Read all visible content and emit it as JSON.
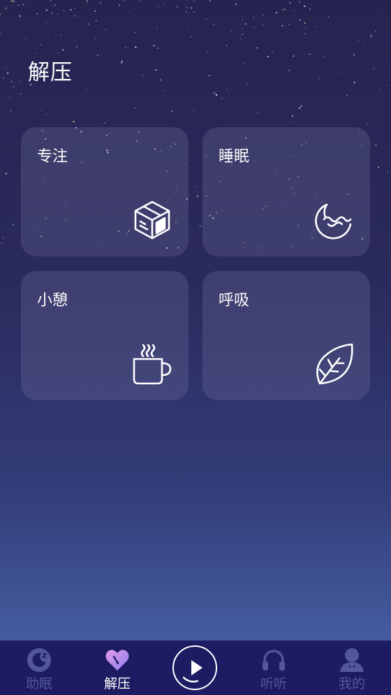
{
  "page": {
    "title": "解压"
  },
  "cards": [
    {
      "label": "专注",
      "icon": "cube-icon"
    },
    {
      "label": "睡眠",
      "icon": "moon-icon"
    },
    {
      "label": "小憩",
      "icon": "coffee-cup-icon"
    },
    {
      "label": "呼吸",
      "icon": "leaf-icon"
    }
  ],
  "tabbar": {
    "items": [
      {
        "label": "助眠",
        "icon": "sleep-moon-icon",
        "active": false
      },
      {
        "label": "解压",
        "icon": "heart-icon",
        "active": true
      },
      {
        "label": "",
        "icon": "play-icon",
        "active": false
      },
      {
        "label": "听听",
        "icon": "headphones-icon",
        "active": false
      },
      {
        "label": "我的",
        "icon": "user-icon",
        "active": false
      }
    ]
  },
  "colors": {
    "tab_inactive": "#53579a",
    "tab_active": "#ffffff",
    "tabbar_bg": "#1d1c63",
    "heart_gradient_start": "#e39ce8",
    "heart_gradient_end": "#8f7ff2"
  }
}
